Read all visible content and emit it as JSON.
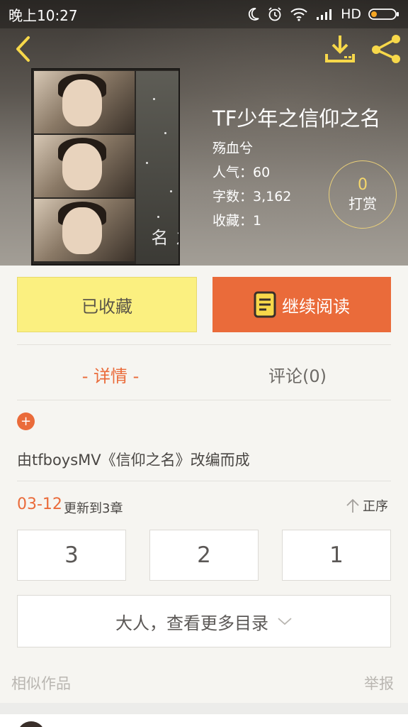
{
  "status_bar": {
    "time": "晚上10:27",
    "network": "HD"
  },
  "header": {
    "back_icon": "chevron-left-icon",
    "download_icon": "download-icon",
    "share_icon": "share-icon"
  },
  "book": {
    "cover_title": "信仰之名",
    "title": "TF少年之信仰之名",
    "author": "殇血兮",
    "popularity_label": "人气",
    "popularity": "60",
    "word_count_label": "字数",
    "word_count": "3,162",
    "favorites_label": "收藏",
    "favorites": "1",
    "popularity_text": "人气：60",
    "word_count_text": "字数：3,162",
    "favorites_text": "收藏：1"
  },
  "tip": {
    "count": "0",
    "label": "打赏"
  },
  "actions": {
    "collected_label": "已收藏",
    "continue_label": "继续阅读",
    "continue_icon": "book-icon"
  },
  "tabs": [
    {
      "label": "- 详情 -",
      "active": true
    },
    {
      "label": "评论(0)",
      "active": false
    }
  ],
  "detail": {
    "expand_icon": "plus-icon",
    "synopsis": "由tfboysMV《信仰之名》改编而成",
    "update_date": "03-12",
    "update_text": "更新到3章",
    "sort_label": "正序",
    "sort_icon": "arrow-up-icon",
    "chapters": [
      "3",
      "2",
      "1"
    ],
    "more_label": "大人，查看更多目录",
    "more_icon": "chevron-down-icon"
  },
  "footer": {
    "similar_label": "相似作品",
    "report_label": "举报"
  },
  "colors": {
    "accent": "#ea6b3a",
    "collected_bg": "#fbf080",
    "tip_gold": "#f5d76b"
  }
}
